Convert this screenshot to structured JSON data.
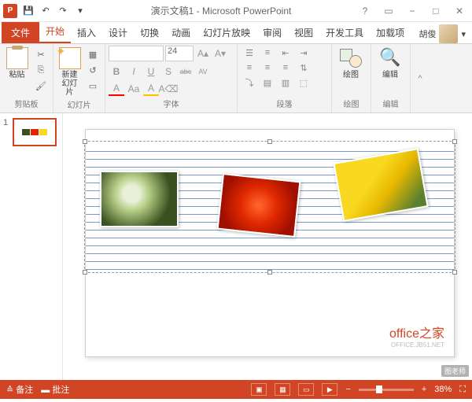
{
  "title": "演示文稿1 - Microsoft PowerPoint",
  "tabs": {
    "file": "文件",
    "home": "开始",
    "insert": "插入",
    "design": "设计",
    "transitions": "切换",
    "animations": "动画",
    "slideshow": "幻灯片放映",
    "review": "审阅",
    "view": "视图",
    "developer": "开发工具",
    "addins": "加载项"
  },
  "user": "胡俊",
  "ribbon": {
    "clipboard": {
      "paste": "粘贴",
      "label": "剪贴板"
    },
    "slides": {
      "new": "新建\n幻灯片",
      "label": "幻灯片"
    },
    "font": {
      "size": "24",
      "b": "B",
      "i": "I",
      "u": "U",
      "s": "S",
      "abc": "abc",
      "av": "AV",
      "a_big": "A",
      "aa": "Aa",
      "a_small": "A",
      "label": "字体"
    },
    "para": {
      "label": "段落"
    },
    "draw": {
      "shapes": "绘图",
      "label": "绘图"
    },
    "edit": {
      "find": "编辑",
      "label": "编辑"
    }
  },
  "thumbnail": {
    "num": "1"
  },
  "watermark": {
    "line1": "office之家",
    "line2": "OFFICE.JB51.NET",
    "corner": "图老师"
  },
  "status": {
    "notes": "备注",
    "comments": "批注",
    "zoom": "38%",
    "minus": "−",
    "plus": "+"
  }
}
